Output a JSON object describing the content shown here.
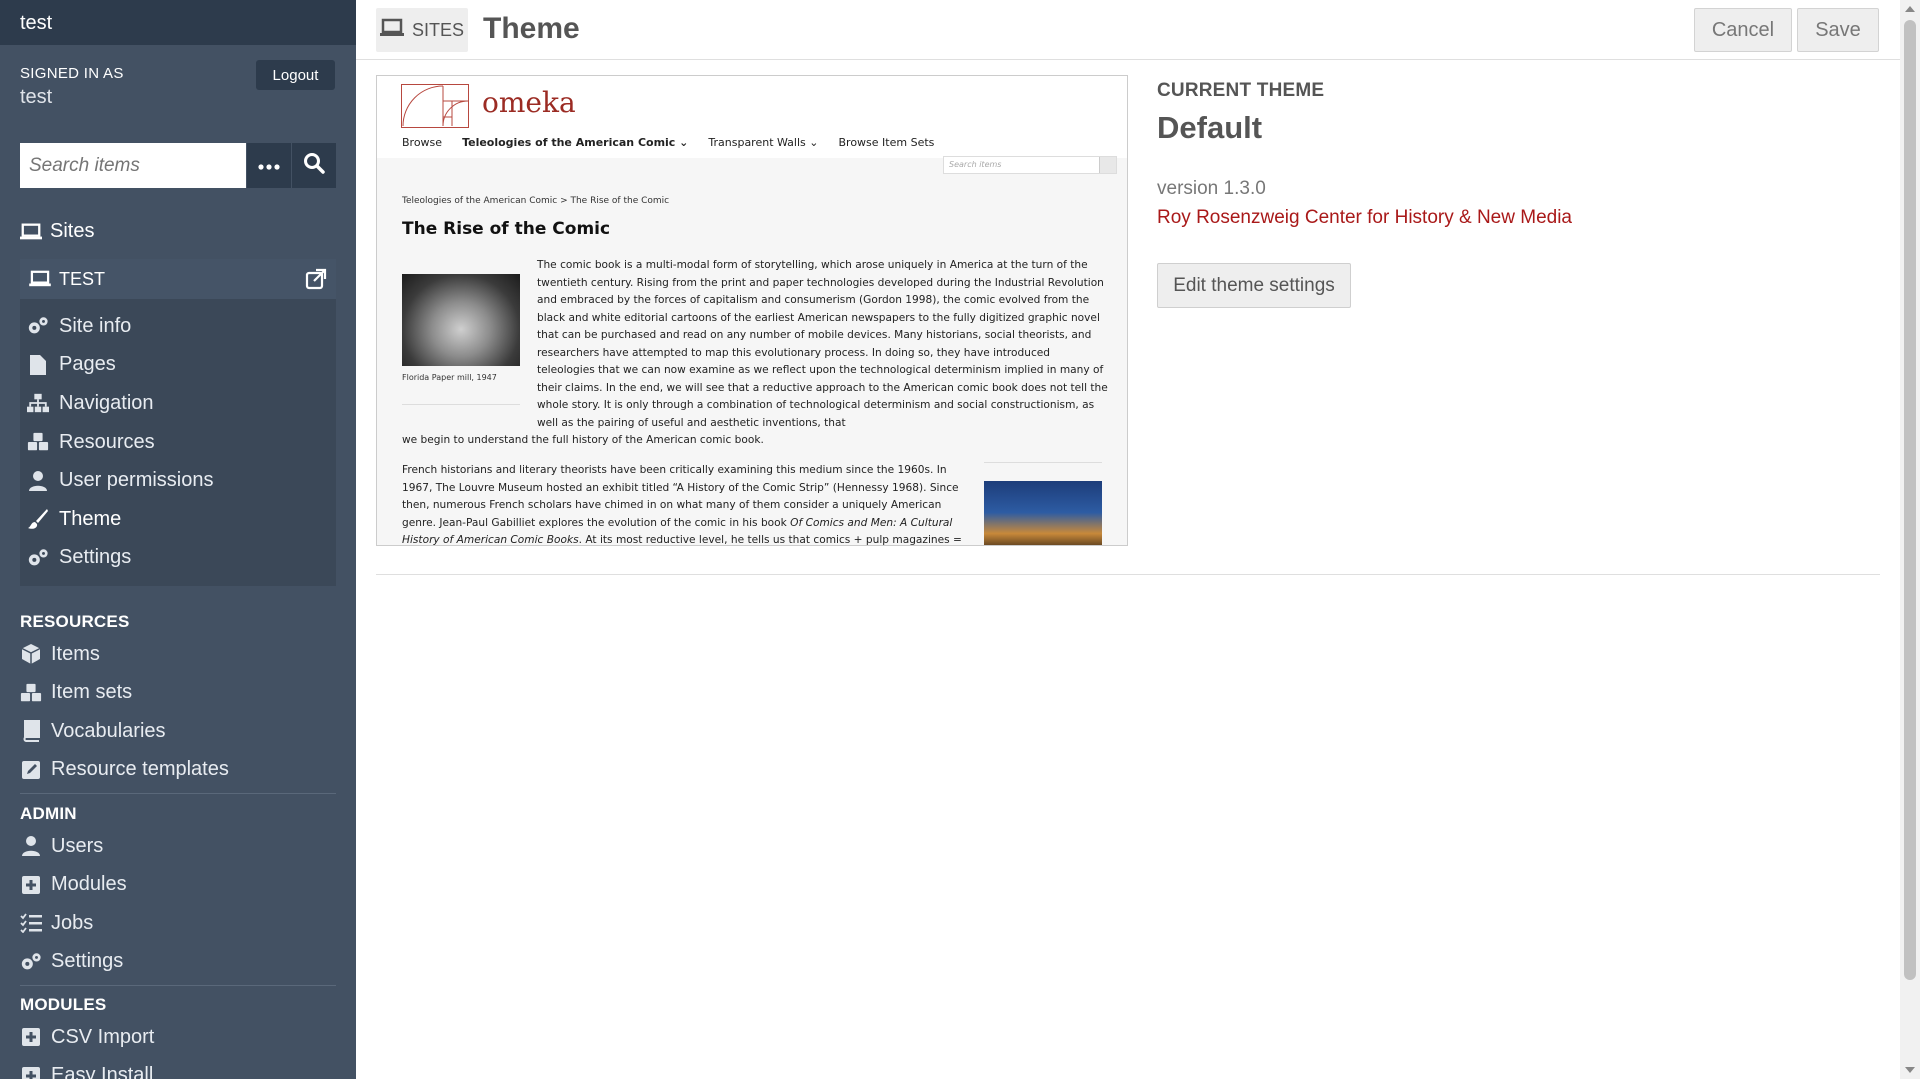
{
  "sidebar": {
    "site_title": "test",
    "signed_in_label": "SIGNED IN AS",
    "user": "test",
    "logout": "Logout",
    "search_placeholder": "Search items",
    "sites_heading": "Sites",
    "current_site": "TEST",
    "site_menu": [
      "Site info",
      "Pages",
      "Navigation",
      "Resources",
      "User permissions",
      "Theme",
      "Settings"
    ],
    "resources_heading": "RESOURCES",
    "resources": [
      "Items",
      "Item sets",
      "Vocabularies",
      "Resource templates"
    ],
    "admin_heading": "ADMIN",
    "admin": [
      "Users",
      "Modules",
      "Jobs",
      "Settings"
    ],
    "modules_heading": "MODULES",
    "modules": [
      "CSV Import",
      "Easy Install"
    ]
  },
  "header": {
    "breadcrumb": "SITES",
    "title": "Theme",
    "cancel": "Cancel",
    "save": "Save"
  },
  "preview": {
    "brand": "omeka",
    "nav": [
      "Browse",
      "Teleologies of the American Comic",
      "Transparent Walls",
      "Browse Item Sets"
    ],
    "search_placeholder": "Search items",
    "breadcrumb": "Teleologies of the American Comic > The Rise of the Comic",
    "title": "The Rise of the Comic",
    "caption": "Florida Paper mill, 1947",
    "para1": "The comic book is a multi-modal form of storytelling, which arose uniquely in America at the turn of the twentieth century. Rising from the print and paper technologies developed during the Industrial Revolution and embraced by the forces of capitalism and consumerism (Gordon 1998), the comic evolved from the black and white editorial cartoons of the earliest American newspapers to the fully digitized graphic novel that can be purchased and read on any number of mobile devices. Many historians, social theorists, and researchers have attempted to map this evolutionary process. In doing so, they have introduced teleologies that we can now examine as we reflect upon the technological determinism implied in many of their claims. In the end, we will see that a reductive approach to the American comic book does not tell the whole story. It is only through a combination of technological determinism and social constructionism, as well as the pairing of useful and aesthetic inventions, that",
    "para1_end": "we begin to understand the full history of the American comic book.",
    "para2_a": "French historians and literary theorists have been critically examining this medium since the 1960s. In 1967, The Louvre Museum hosted an exhibit titled “A History of the Comic Strip” (Hennessy 1968). Since then, numerous French scholars have chimed in on what many of them consider a uniquely American genre. Jean-Paul Gabilliet explores the evolution of the comic in his book ",
    "para2_book": "Of Comics and Men: A Cultural History of American Comic Books",
    "para2_b": ". At its most reductive level, he tells us that comics + pulp magazines ="
  },
  "theme": {
    "current_label": "CURRENT THEME",
    "name": "Default",
    "version": "version 1.3.0",
    "author": "Roy Rosenzweig Center for History & New Media",
    "edit_button": "Edit theme settings"
  },
  "colors": {
    "sidebar_bg": "#435163",
    "sidebar_dark": "#2d3b4c",
    "link_red": "#a91919"
  }
}
